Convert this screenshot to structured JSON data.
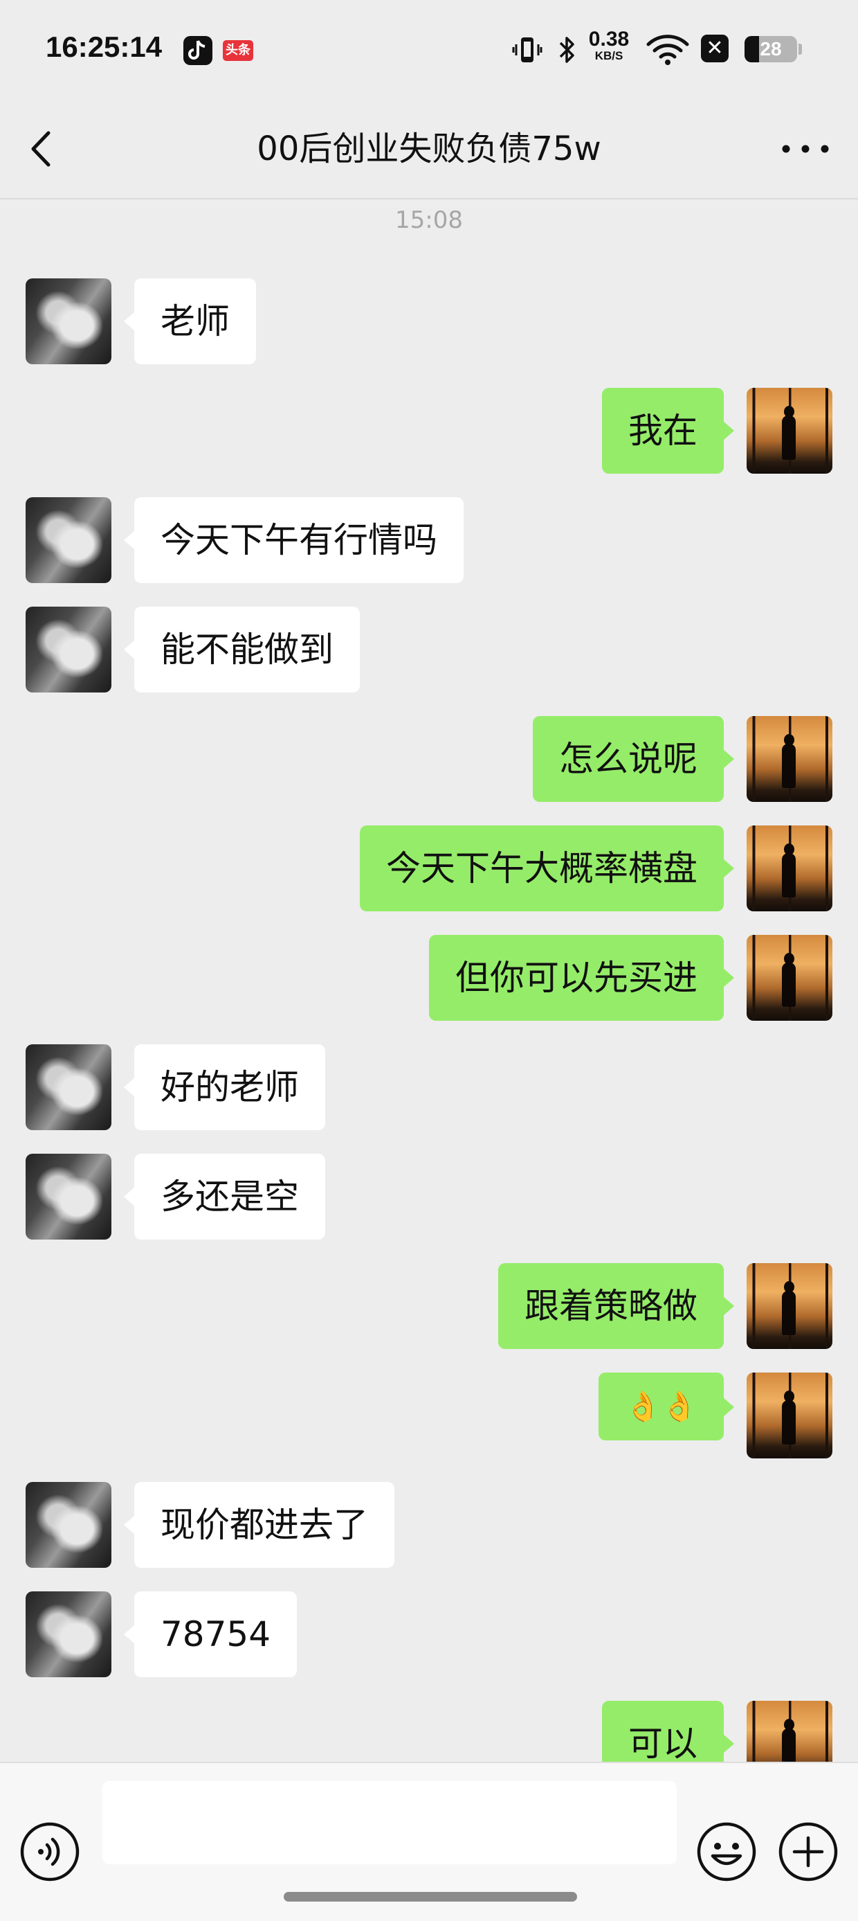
{
  "status_bar": {
    "time": "16:25:14",
    "toutiao_badge": "头条",
    "net_speed_value": "0.38",
    "net_speed_unit": "KB/S",
    "battery_level": "28",
    "battery_fraction": 0.28,
    "icons": [
      "tiktok-icon",
      "toutiao-icon",
      "vibrate-icon",
      "bluetooth-icon",
      "wifi-icon",
      "x-app-icon",
      "battery-icon"
    ]
  },
  "nav": {
    "title": "00后创业失败负债75w",
    "back_icon": "chevron-left-icon",
    "more_icon": "more-icon"
  },
  "chat": {
    "timestamp": "15:08",
    "messages": [
      {
        "side": "left",
        "text": "老师"
      },
      {
        "side": "right",
        "text": "我在"
      },
      {
        "side": "left",
        "text": "今天下午有行情吗"
      },
      {
        "side": "left",
        "text": "能不能做到"
      },
      {
        "side": "right",
        "text": "怎么说呢"
      },
      {
        "side": "right",
        "text": "今天下午大概率横盘"
      },
      {
        "side": "right",
        "text": "但你可以先买进"
      },
      {
        "side": "left",
        "text": "好的老师"
      },
      {
        "side": "left",
        "text": "多还是空"
      },
      {
        "side": "right",
        "text": "跟着策略做"
      },
      {
        "side": "right",
        "text": "👌👌"
      },
      {
        "side": "left",
        "text": "现价都进去了"
      },
      {
        "side": "left",
        "text": "78754"
      },
      {
        "side": "right",
        "text": "可以"
      }
    ]
  },
  "input_bar": {
    "placeholder": "",
    "icons": [
      "voice-icon",
      "emoji-icon",
      "add-icon"
    ]
  },
  "colors": {
    "background": "#ededed",
    "bubble_self": "#95ec69",
    "bubble_other": "#ffffff",
    "timestamp": "#a6a6a6"
  }
}
